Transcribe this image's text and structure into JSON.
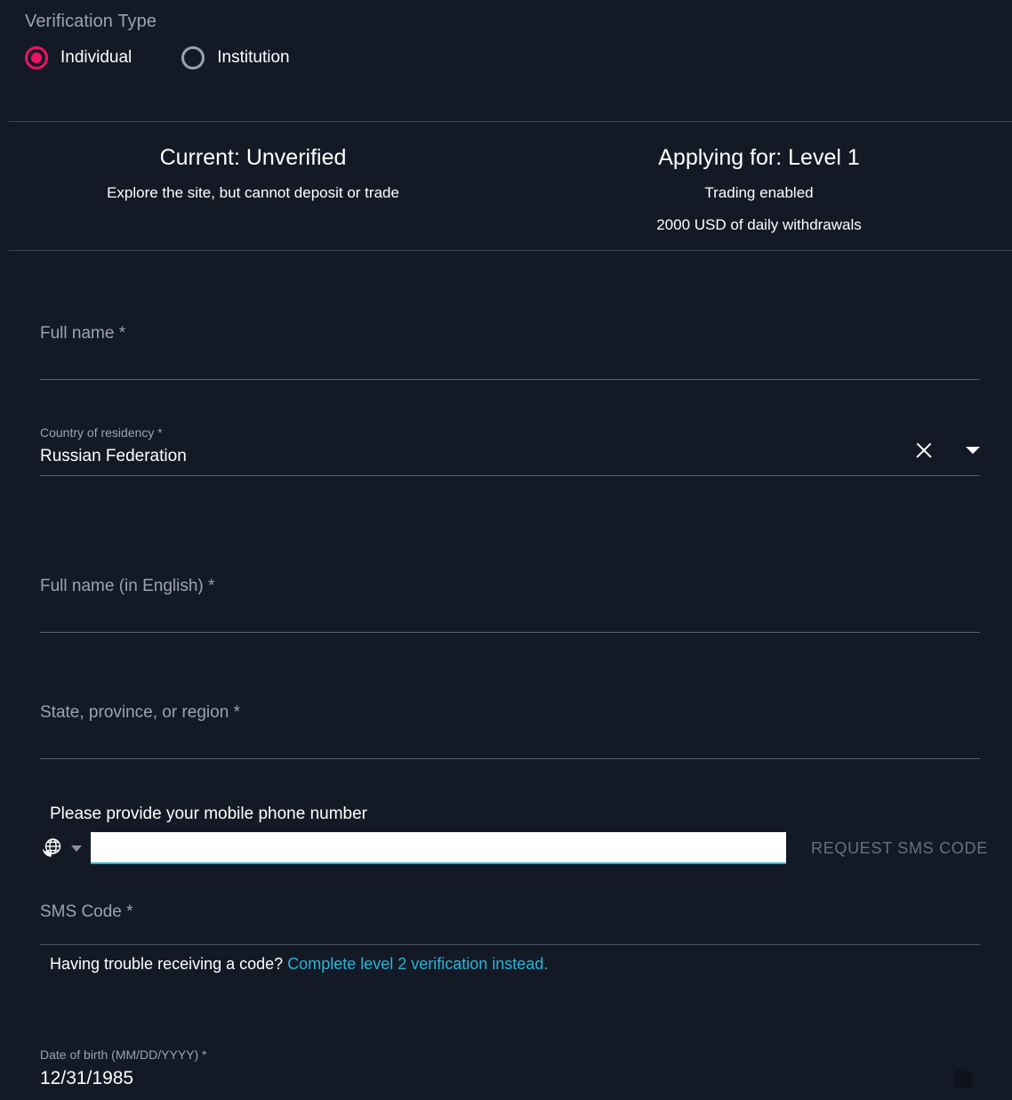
{
  "verification": {
    "title": "Verification Type",
    "options": [
      {
        "label": "Individual",
        "selected": true
      },
      {
        "label": "Institution",
        "selected": false
      }
    ]
  },
  "status": {
    "current": {
      "heading": "Current: Unverified",
      "lines": [
        "Explore the site, but cannot deposit or trade"
      ]
    },
    "applying": {
      "heading": "Applying for: Level 1",
      "lines": [
        "Trading enabled",
        "2000 USD of daily withdrawals"
      ]
    }
  },
  "form": {
    "full_name": {
      "label": "Full name *",
      "value": "",
      "placeholder": ""
    },
    "country": {
      "label": "Country of residency *",
      "value": "Russian Federation",
      "clear_icon": "close-icon",
      "dropdown_icon": "chevron-down-icon"
    },
    "full_name_en": {
      "label": "Full name (in English) *",
      "value": "",
      "placeholder": ""
    },
    "state": {
      "label": "State, province, or region *",
      "value": "",
      "placeholder": ""
    },
    "phone": {
      "title": "Please provide your mobile phone number",
      "country_icon": "globe-phone-icon",
      "dropdown_icon": "caret-down-icon",
      "value": "",
      "placeholder": "",
      "request_button": "REQUEST SMS CODE"
    },
    "sms_code": {
      "label": "SMS Code *",
      "value": "",
      "helper_text": "Having trouble receiving a code?",
      "helper_link": "Complete level 2 verification instead."
    },
    "dob": {
      "label": "Date of birth (MM/DD/YYYY) *",
      "value": "12/31/1985",
      "calendar_icon": "calendar-icon"
    }
  },
  "colors": {
    "background": "#131a26",
    "accent_pink": "#ef1164",
    "accent_teal": "#2bb3d6",
    "muted_text": "#9aa3b0",
    "divider": "#3a4352",
    "disabled_text": "#67707f"
  }
}
